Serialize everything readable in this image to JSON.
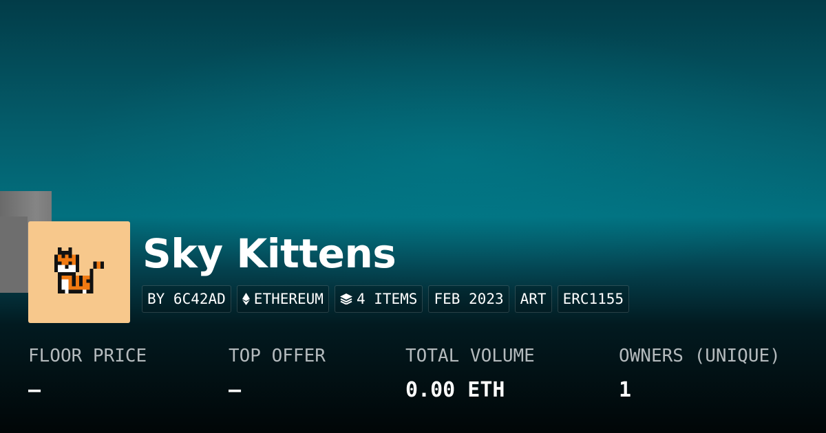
{
  "collection": {
    "title": "Sky Kittens",
    "avatar_icon": "pixel-tiger-icon",
    "avatar_background": "#f7c88c"
  },
  "tags": [
    {
      "label": "BY 6C42AD"
    },
    {
      "label": "ETHEREUM",
      "icon": "ethereum-icon"
    },
    {
      "label": "4 ITEMS",
      "icon": "layers-icon"
    },
    {
      "label": "FEB 2023"
    },
    {
      "label": "ART"
    },
    {
      "label": "ERC1155"
    }
  ],
  "stats": [
    {
      "label": "FLOOR PRICE",
      "value": "—"
    },
    {
      "label": "TOP OFFER",
      "value": "—"
    },
    {
      "label": "TOTAL VOLUME",
      "value": "0.00 ETH"
    },
    {
      "label": "OWNERS (UNIQUE)",
      "value": "1"
    }
  ],
  "colors": {
    "banner_teal": "#02707f",
    "bottom_black": "#010607",
    "label_gray": "#b4babd"
  }
}
